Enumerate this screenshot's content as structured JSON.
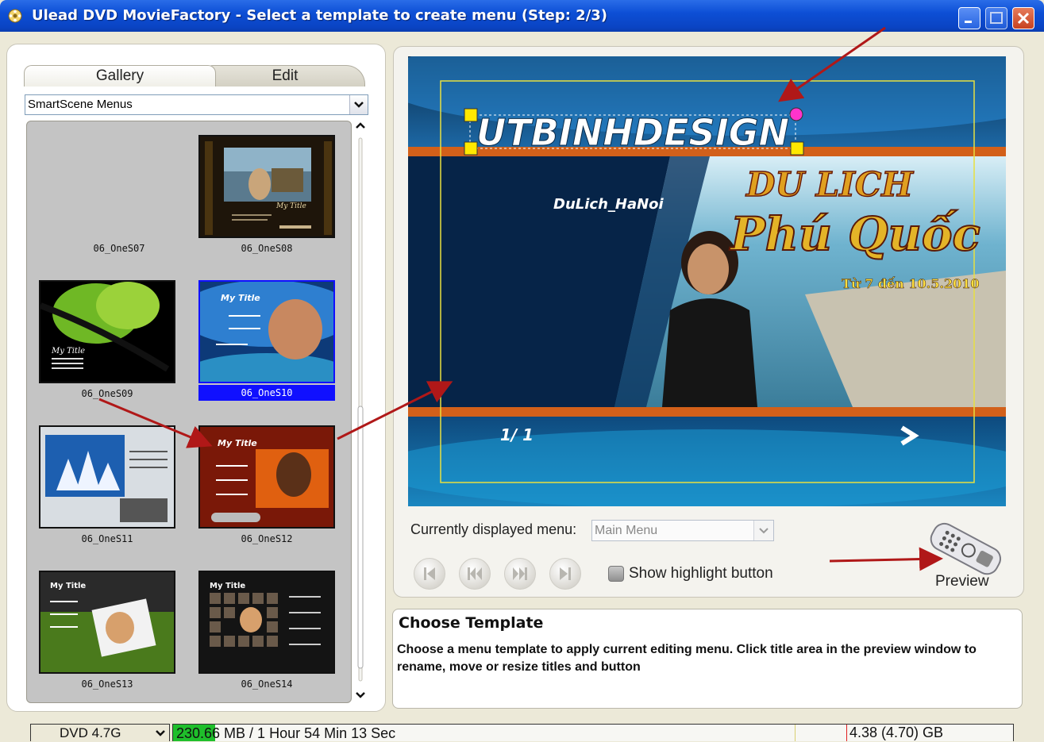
{
  "window": {
    "title": "Ulead DVD MovieFactory - Select a template to create menu (Step: 2/3)",
    "icon": "film-reel-icon",
    "buttons": [
      "minimize-icon",
      "maximize-icon",
      "close-icon"
    ]
  },
  "tabs": {
    "gallery": "Gallery",
    "edit": "Edit"
  },
  "category_select": {
    "value": "SmartScene Menus"
  },
  "thumbnails": [
    {
      "label": "06_OneS07",
      "selected": false
    },
    {
      "label": "06_OneS08",
      "selected": false
    },
    {
      "label": "06_OneS09",
      "selected": false
    },
    {
      "label": "06_OneS10",
      "selected": true
    },
    {
      "label": "06_OneS11",
      "selected": false
    },
    {
      "label": "06_OneS12",
      "selected": false
    },
    {
      "label": "06_OneS13",
      "selected": false
    },
    {
      "label": "06_OneS14",
      "selected": false
    }
  ],
  "thumb_texts": {
    "my_title": "My Title",
    "my_title_script": "My Title"
  },
  "preview": {
    "title_text": "UTBINHDESIGN",
    "subtitle": "DuLich_HaNoi",
    "headline": "DU LICH",
    "script_title": "Phú Quốc",
    "date": "Từ 7 đến 10.5.2010",
    "page": "1/ 1",
    "next_icon": "chevron-right-icon"
  },
  "menu_controls": {
    "current_label": "Currently displayed menu:",
    "current_value": "Main Menu",
    "highlight_label": "Show highlight button",
    "preview_label": "Preview",
    "nav_icons": [
      "first-icon",
      "prev-icon",
      "next-icon",
      "last-icon"
    ]
  },
  "info": {
    "title": "Choose Template",
    "body": "Choose a menu template to apply current editing menu. Click title area in the preview window to rename, move or resize titles and button"
  },
  "status": {
    "disc": "DVD 4.7G",
    "usage": "230.66 MB / 1 Hour 54 Min 13 Sec",
    "usage_fraction": 0.05,
    "capacity": "4.38 (4.70) GB"
  },
  "colors": {
    "accent": "#0a44c4",
    "selection": "#1010ff",
    "annotation_arrow": "#b01818",
    "usage_fill": "#1fbf2b"
  }
}
